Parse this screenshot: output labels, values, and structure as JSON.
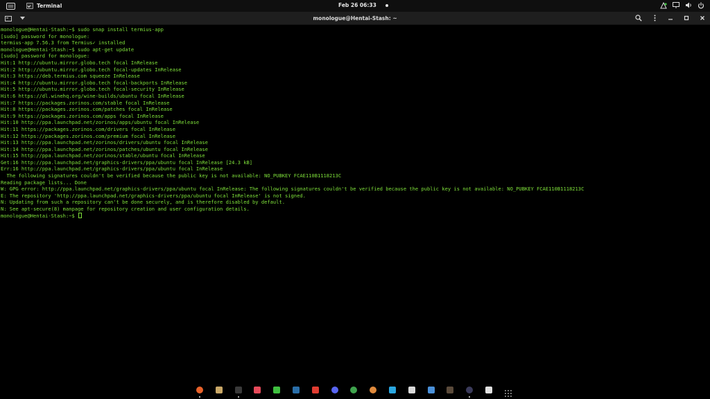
{
  "top_panel": {
    "app_name": "Terminal",
    "clock": "Feb 26  06:33"
  },
  "terminal": {
    "title": "monologue@Hentai-Stash: ~",
    "lines": [
      "monologue@Hentai-Stash:~$ sudo snap install termius-app",
      "[sudo] password for monologue:",
      "termius-app 7.56.3 from Termius✓ installed",
      "monologue@Hentai-Stash:~$ sudo apt-get update",
      "[sudo] password for monologue:",
      "Hit:1 http://ubuntu.mirror.globo.tech focal InRelease",
      "Hit:2 http://ubuntu.mirror.globo.tech focal-updates InRelease",
      "Hit:3 https://deb.termius.com squeeze InRelease",
      "Hit:4 http://ubuntu.mirror.globo.tech focal-backports InRelease",
      "Hit:5 http://ubuntu.mirror.globo.tech focal-security InRelease",
      "Hit:6 https://dl.winehq.org/wine-builds/ubuntu focal InRelease",
      "Hit:7 https://packages.zorinos.com/stable focal InRelease",
      "Hit:8 https://packages.zorinos.com/patches focal InRelease",
      "Hit:9 https://packages.zorinos.com/apps focal InRelease",
      "Hit:10 http://ppa.launchpad.net/zorinos/apps/ubuntu focal InRelease",
      "Hit:11 https://packages.zorinos.com/drivers focal InRelease",
      "Hit:12 https://packages.zorinos.com/premium focal InRelease",
      "Hit:13 http://ppa.launchpad.net/zorinos/drivers/ubuntu focal InRelease",
      "Hit:14 http://ppa.launchpad.net/zorinos/patches/ubuntu focal InRelease",
      "Hit:15 http://ppa.launchpad.net/zorinos/stable/ubuntu focal InRelease",
      "Get:16 http://ppa.launchpad.net/graphics-drivers/ppa/ubuntu focal InRelease [24.3 kB]",
      "Err:16 http://ppa.launchpad.net/graphics-drivers/ppa/ubuntu focal InRelease",
      "  The following signatures couldn't be verified because the public key is not available: NO_PUBKEY FCAE110B1118213C",
      "Reading package lists... Done",
      "W: GPG error: http://ppa.launchpad.net/graphics-drivers/ppa/ubuntu focal InRelease: The following signatures couldn't be verified because the public key is not available: NO_PUBKEY FCAE110B1118213C",
      "E: The repository 'http://ppa.launchpad.net/graphics-drivers/ppa/ubuntu focal InRelease' is not signed.",
      "N: Updating from such a repository can't be done securely, and is therefore disabled by default.",
      "N: See apt-secure(8) manpage for repository creation and user configuration details."
    ],
    "prompt": "monologue@Hentai-Stash:~$ "
  },
  "dock": {
    "items": [
      {
        "name": "firefox-icon",
        "color": "#e8622a",
        "running": true
      },
      {
        "name": "files-icon",
        "color": "#c9a867",
        "running": false
      },
      {
        "name": "terminal-icon",
        "color": "#3a3a3a",
        "running": true
      },
      {
        "name": "software-store-icon",
        "color": "#e64a5a",
        "running": false
      },
      {
        "name": "lock-icon",
        "color": "#3fbf3f",
        "running": false
      },
      {
        "name": "steam-icon",
        "color": "#2a6ea8",
        "running": false
      },
      {
        "name": "anydesk-icon",
        "color": "#e03c31",
        "running": false
      },
      {
        "name": "discord-icon",
        "color": "#5865f2",
        "running": false
      },
      {
        "name": "globe-icon",
        "color": "#3fa34d",
        "running": false
      },
      {
        "name": "pizza-icon",
        "color": "#e08a3c",
        "running": false
      },
      {
        "name": "editor-icon",
        "color": "#2aa7e0",
        "running": false
      },
      {
        "name": "screen-recorder-icon",
        "color": "#d9d9d9",
        "running": false
      },
      {
        "name": "finder-icon",
        "color": "#4a90d9",
        "running": false
      },
      {
        "name": "game-icon",
        "color": "#5a4a3a",
        "running": false
      },
      {
        "name": "obs-icon",
        "color": "#3a3a5a",
        "running": true
      },
      {
        "name": "trash-icon",
        "color": "#e0e0e0",
        "running": false
      },
      {
        "name": "app-grid-icon",
        "color": "#cfcfcf",
        "running": false
      }
    ]
  }
}
